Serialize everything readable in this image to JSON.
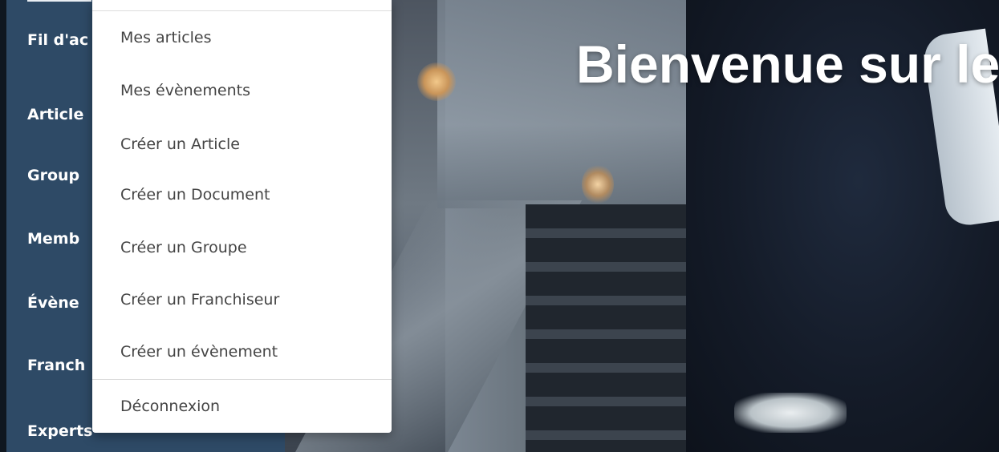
{
  "sidebar": {
    "items": [
      {
        "label": "Fil d'ac"
      },
      {
        "label": "Article"
      },
      {
        "label": "Group"
      },
      {
        "label": "Memb"
      },
      {
        "label": "Évène"
      },
      {
        "label": "Franch"
      },
      {
        "label": "Experts"
      }
    ]
  },
  "hero": {
    "title": "Bienvenue sur le"
  },
  "dropdown": {
    "items": [
      {
        "label": "Mes articles"
      },
      {
        "label": "Mes évènements"
      },
      {
        "label": "Créer un Article"
      },
      {
        "label": "Créer un Document"
      },
      {
        "label": "Créer un Groupe"
      },
      {
        "label": "Créer un Franchiseur"
      },
      {
        "label": "Créer un évènement"
      }
    ],
    "logout_label": "Déconnexion"
  },
  "colors": {
    "sidebar_bg": "#2e4a66",
    "dropdown_bg": "#ffffff",
    "menu_text": "#444444"
  }
}
